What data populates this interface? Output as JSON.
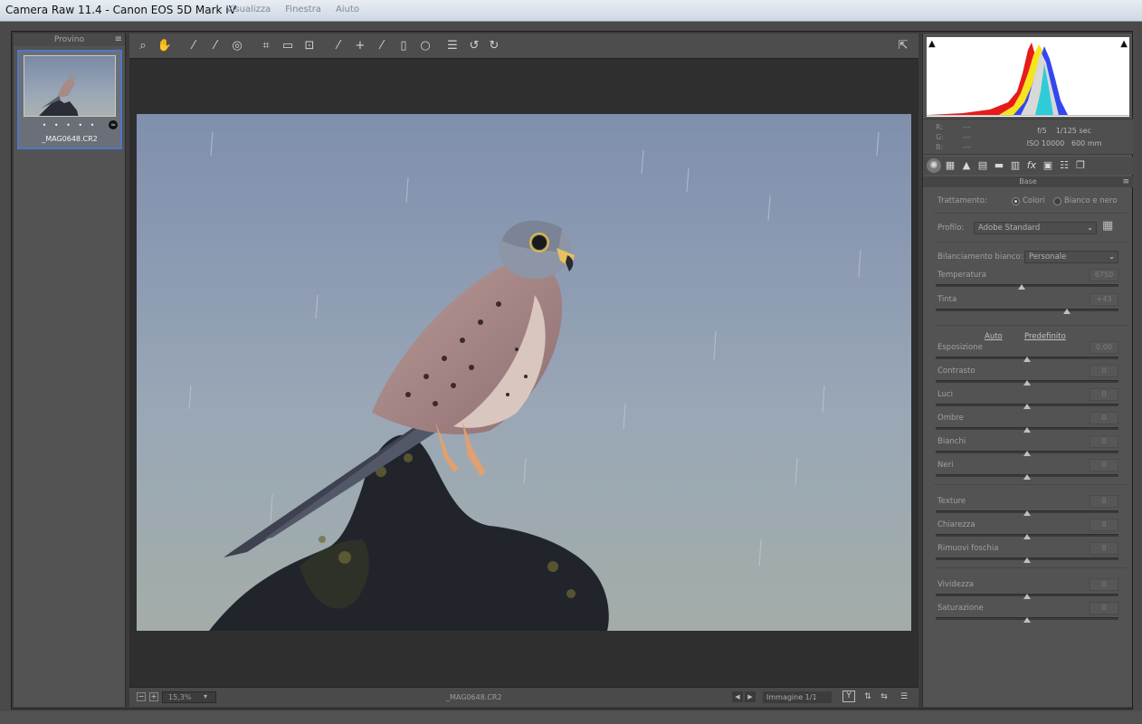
{
  "window": {
    "title": "Camera Raw 11.4  -  Canon EOS 5D Mark IV",
    "background_menu": [
      "Visualizza",
      "Finestra",
      "Aiuto"
    ]
  },
  "filmstrip": {
    "title": "Provino",
    "menu_icon": "menu-lines-icon",
    "thumbnail": {
      "rating_dots": "• • • • •",
      "filename": "_MAG0648.CR2",
      "badge_icon": "adjust-badge-icon"
    }
  },
  "toolbar": {
    "tools": [
      {
        "name": "zoom-tool",
        "icon": "magnifier-icon",
        "glyph": "🔍"
      },
      {
        "name": "hand-tool",
        "icon": "hand-icon",
        "glyph": "✋"
      },
      {
        "name": "white-balance-tool",
        "icon": "eyedropper-icon",
        "glyph": "⁄"
      },
      {
        "name": "color-sampler-tool",
        "icon": "eyedropper-plus-icon",
        "glyph": "⁄"
      },
      {
        "name": "targeted-adjustment-tool",
        "icon": "target-icon",
        "glyph": "◎"
      },
      {
        "name": "crop-tool",
        "icon": "crop-icon",
        "glyph": "⌗"
      },
      {
        "name": "straighten-tool",
        "icon": "straighten-icon",
        "glyph": "▭"
      },
      {
        "name": "transform-tool",
        "icon": "transform-icon",
        "glyph": "⊡"
      },
      {
        "name": "spot-removal-tool",
        "icon": "brush-icon",
        "glyph": "⁄"
      },
      {
        "name": "red-eye-tool",
        "icon": "eye-plus-icon",
        "glyph": "+"
      },
      {
        "name": "adjustment-brush-tool",
        "icon": "paintbrush-icon",
        "glyph": "⁄"
      },
      {
        "name": "graduated-filter-tool",
        "icon": "gradient-icon",
        "glyph": "▯"
      },
      {
        "name": "radial-filter-tool",
        "icon": "ellipse-icon",
        "glyph": "○"
      },
      {
        "name": "preferences-tool",
        "icon": "list-icon",
        "glyph": "☰"
      },
      {
        "name": "rotate-left-tool",
        "icon": "rotate-left-icon",
        "glyph": "↺"
      },
      {
        "name": "rotate-right-tool",
        "icon": "rotate-right-icon",
        "glyph": "↻"
      }
    ],
    "fullscreen_icon": "fullscreen-toggle-icon"
  },
  "statusbar": {
    "zoom_value": "15,3%",
    "filename": "_MAG0648.CR2",
    "image_count": "Immagine 1/1",
    "yy_label": "Y"
  },
  "histogram": {
    "shadow_clip_icon": "shadow-clip-warning-icon",
    "highlight_clip_icon": "highlight-clip-warning-icon"
  },
  "readout": {
    "r_label": "R:",
    "g_label": "G:",
    "b_label": "B:",
    "r_value": "---",
    "g_value": "---",
    "b_value": "---",
    "aperture": "f/5",
    "shutter": "1/125 sec",
    "iso": "ISO 10000",
    "focal": "600 mm"
  },
  "panel_tabs": [
    "basic-aperture-icon",
    "tone-curve-grid-icon",
    "detail-mountain-icon",
    "hsl-icon",
    "split-toning-icon",
    "lens-icon",
    "fx-icon",
    "calibration-film-icon",
    "presets-sliders-icon",
    "snapshots-icon"
  ],
  "base_panel": {
    "header": "Base",
    "treatment_label": "Trattamento:",
    "treatment_color": "Colori",
    "treatment_bw": "Bianco e nero",
    "profile_label": "Profilo:",
    "profile_value": "Adobe Standard",
    "wb_label": "Bilanciamento bianco:",
    "wb_value": "Personale",
    "auto_label": "Auto",
    "default_label": "Predefinito",
    "sliders": {
      "temperatura": {
        "label": "Temperatura",
        "value": "6750",
        "pos": 0.47
      },
      "tinta": {
        "label": "Tinta",
        "value": "+43",
        "pos": 0.72
      },
      "esposizione": {
        "label": "Esposizione",
        "value": "0,00",
        "pos": 0.5
      },
      "contrasto": {
        "label": "Contrasto",
        "value": "0",
        "pos": 0.5
      },
      "luci": {
        "label": "Luci",
        "value": "0",
        "pos": 0.5
      },
      "ombre": {
        "label": "Ombre",
        "value": "0",
        "pos": 0.5
      },
      "bianchi": {
        "label": "Bianchi",
        "value": "0",
        "pos": 0.5
      },
      "neri": {
        "label": "Neri",
        "value": "0",
        "pos": 0.5
      },
      "texture": {
        "label": "Texture",
        "value": "0",
        "pos": 0.5
      },
      "chiarezza": {
        "label": "Chiarezza",
        "value": "0",
        "pos": 0.5
      },
      "foschia": {
        "label": "Rimuovi foschia",
        "value": "0",
        "pos": 0.5
      },
      "vividezza": {
        "label": "Vividezza",
        "value": "0",
        "pos": 0.5
      },
      "saturazione": {
        "label": "Saturazione",
        "value": "0",
        "pos": 0.5
      }
    }
  }
}
